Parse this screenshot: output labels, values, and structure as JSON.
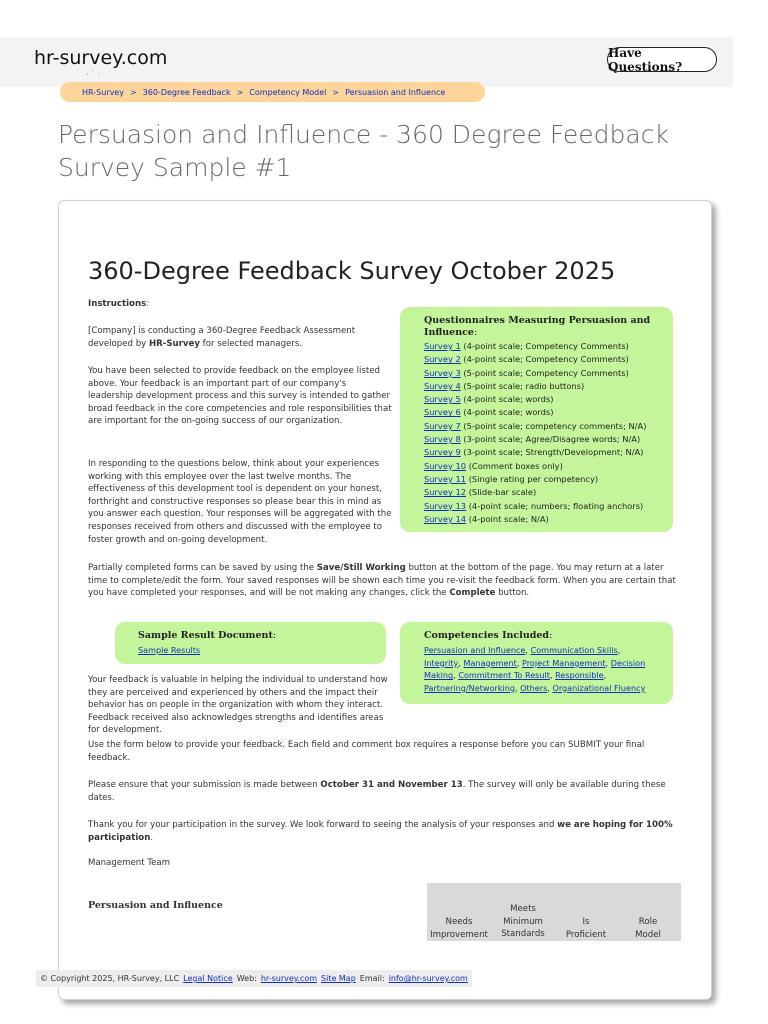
{
  "header": {
    "logo_text": "hr-survey.com",
    "logo_dots": "· ˙ ·",
    "have_questions": "Have Questions?"
  },
  "breadcrumb": [
    "HR-Survey",
    "360-Degree Feedback",
    "Competency Model",
    "Persuasion and Influence"
  ],
  "breadcrumb_sep": ">",
  "page_title": "Persuasion and Influence - 360 Degree Feedback Survey Sample #1",
  "survey": {
    "title": "360-Degree Feedback Survey October 2025",
    "instructions_label": "Instructions",
    "intro_1a": "[Company] is conducting a 360-Degree Feedback Assessment developed by ",
    "intro_1b": "HR-Survey",
    "intro_1c": " for selected managers.",
    "intro_2": "You have been selected to provide feedback on the employee listed above. Your feedback is an important part of our company's leadership development process and this survey is intended to gather broad feedback in the core competencies and role responsibilities that are important for the on-going success of our organization.",
    "intro_3": "In responding to the questions below, think about your experiences working with this employee over the last twelve months. The effectiveness of this development tool is dependent on your honest, forthright and constructive responses so please bear this in mind as you answer each question. Your responses will be aggregated with the responses received from others and discussed with the employee to foster growth and on-going development.",
    "partial_a": "Partially completed forms can be saved by using the ",
    "partial_b": "Save/Still Working",
    "partial_c": " button at the bottom of the page. You may return at a later time to complete/edit the form. Your saved responses will be shown each time you re-visit the feedback form. When you are certain that you have completed your responses, and will be not making any changes, click the ",
    "partial_d": "Complete",
    "partial_e": " button.",
    "valuable": "Your feedback is valuable in helping the individual to understand how they are perceived and experienced by others and the impact their behavior has on people in the organization with whom they interact. Feedback received also acknowledges strengths and identifies areas for development.",
    "use_form": "Use the form below to provide your feedback. Each field and comment box requires a response before you can SUBMIT your final feedback.",
    "ensure_a": "Please ensure that your submission is made between ",
    "ensure_b": "October 31 and November 13",
    "ensure_c": ". The survey will only be available during these dates.",
    "thanks_a": "Thank you for your participation in the survey. We look forward to seeing the analysis of your responses and ",
    "thanks_b": "we are hoping for 100% participation",
    "thanks_c": ".",
    "signoff": "Management Team"
  },
  "questionnaires": {
    "heading": "Questionnaires Measuring Persuasion and Influence",
    "items": [
      {
        "link": "Survey 1",
        "desc": " (4-point scale; Competency Comments)"
      },
      {
        "link": "Survey 2",
        "desc": " (4-point scale; Competency Comments)"
      },
      {
        "link": "Survey 3",
        "desc": " (5-point scale; Competency Comments)"
      },
      {
        "link": "Survey 4",
        "desc": " (5-point scale; radio buttons)"
      },
      {
        "link": "Survey 5",
        "desc": " (4-point scale; words)"
      },
      {
        "link": "Survey 6",
        "desc": " (4-point scale; words)"
      },
      {
        "link": "Survey 7",
        "desc": " (5-point scale; competency comments; N/A)"
      },
      {
        "link": "Survey 8",
        "desc": " (3-point scale; Agree/Disagree words; N/A)"
      },
      {
        "link": "Survey 9",
        "desc": " (3-point scale; Strength/Development; N/A)"
      },
      {
        "link": "Survey 10",
        "desc": " (Comment boxes only)"
      },
      {
        "link": "Survey 11",
        "desc": " (Single rating per competency)"
      },
      {
        "link": "Survey 12",
        "desc": " (Slide-bar scale)"
      },
      {
        "link": "Survey 13",
        "desc": " (4-point scale; numbers; floating anchors)"
      },
      {
        "link": "Survey 14",
        "desc": " (4-point scale; N/A)"
      }
    ]
  },
  "sample_result": {
    "heading": "Sample Result Document",
    "link": "Sample Results"
  },
  "competencies": {
    "heading": "Competencies Included",
    "items": [
      "Persuasion and Influence",
      "Communication Skills",
      "Integrity",
      "Management",
      "Project Management",
      "Decision Making",
      "Commitment To Result",
      "Responsible",
      "Partnering/Networking",
      "Others",
      "Organizational Fluency"
    ]
  },
  "table": {
    "section": "Persuasion and Influence",
    "col1_a": "Needs",
    "col1_b": "Improvement",
    "col2_a": "Meets",
    "col2_b": "Minimum",
    "col2_c": "Standards",
    "col3_a": "Is",
    "col3_b": "Proficient",
    "col4_a": "Role",
    "col4_b": "Model"
  },
  "footer": {
    "copyright": "© Copyright 2025, HR-Survey, LLC",
    "legal": "Legal Notice",
    "web_label": "Web:",
    "web": "hr-survey.com",
    "sitemap": "Site Map",
    "email_label": "Email:",
    "email": "info@hr-survey.com"
  }
}
